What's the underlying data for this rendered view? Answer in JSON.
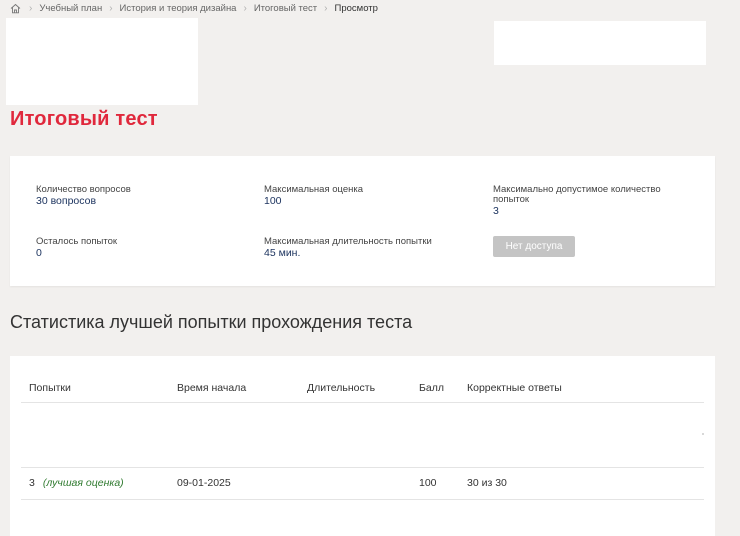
{
  "breadcrumb": {
    "items": [
      "Учебный план",
      "История и теория дизайна",
      "Итоговый тест",
      "Просмотр"
    ]
  },
  "page": {
    "title": "Итоговый тест"
  },
  "info": {
    "questions_label": "Количество вопросов",
    "questions_value": "30 вопросов",
    "max_score_label": "Максимальная оценка",
    "max_score_value": "100",
    "max_attempts_label_line1": "Максимально допустимое количество",
    "max_attempts_label_line2": "попыток",
    "max_attempts_value": "3",
    "remaining_label": "Осталось попыток",
    "remaining_value": "0",
    "max_duration_label": "Максимальная длительность попытки",
    "max_duration_value": "45 мин.",
    "access_button": "Нет доступа"
  },
  "stats": {
    "title": "Статистика лучшей попытки прохождения теста",
    "columns": {
      "attempts": "Попытки",
      "start_time": "Время начала",
      "duration": "Длительность",
      "score": "Балл",
      "correct": "Корректные ответы"
    },
    "row": {
      "attempt": "3",
      "best_note": "(лучшая оценка)",
      "start_time": "09-01-2025",
      "duration": "",
      "score": "100",
      "correct": "30 из 30"
    }
  },
  "colors": {
    "accent": "#e0283c",
    "value_text": "#1e3560",
    "best_note": "#2f7a2f",
    "button_disabled": "#c4c4c4",
    "page_background": "#f2f0ee"
  }
}
